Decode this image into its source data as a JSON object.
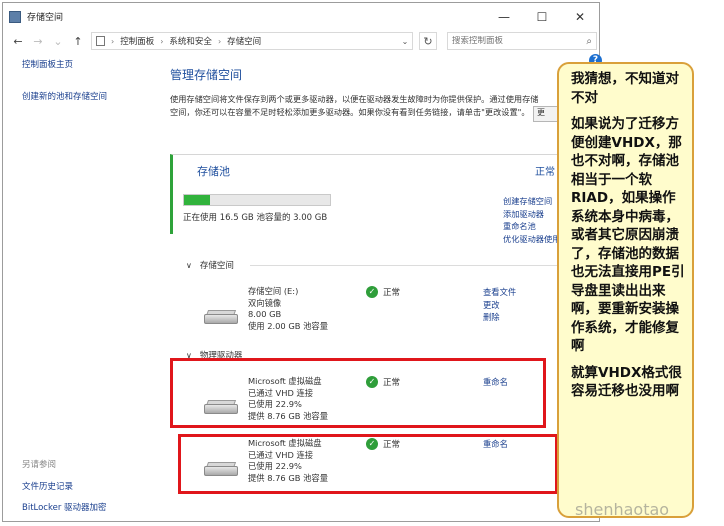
{
  "window": {
    "title": "存储空间",
    "buttons": {
      "minimize": "—",
      "maximize": "☐",
      "close": "✕"
    }
  },
  "address": {
    "back": "←",
    "forward": "→",
    "up": "↑",
    "crumbs": [
      "控制面板",
      "系统和安全",
      "存储空间"
    ],
    "search_placeholder": "搜索控制面板"
  },
  "leftnav": {
    "links": [
      "控制面板主页",
      "创建新的池和存储空间"
    ],
    "see_also": "另请参阅",
    "bottom_links": [
      "文件历史记录",
      "BitLocker 驱动器加密"
    ]
  },
  "main": {
    "title": "管理存储空间",
    "description": "使用存储空间将文件保存到两个或更多驱动器，以便在驱动器发生故障时为你提供保护。通过使用存储空间，你还可以在容量不足时轻松添加更多驱动器。如果你没有看到任务链接，请单击\"更改设置\"。",
    "change_settings": "更"
  },
  "pool": {
    "title": "存储池",
    "status": "正常",
    "usage_fraction": 0.18,
    "usage_text": "正在使用 16.5 GB 池容量的 3.00 GB",
    "links": [
      "创建存储空间",
      "添加驱动器",
      "重命名池",
      "优化驱动器使用"
    ]
  },
  "spaces_section": {
    "label": "存储空间"
  },
  "space": {
    "name": "存储空间 (E:)",
    "type": "双向镜像",
    "size": "8.00 GB",
    "pool_usage": "使用 2.00 GB 池容量",
    "status": "正常",
    "links": [
      "查看文件",
      "更改",
      "删除"
    ]
  },
  "drives_section": {
    "label": "物理驱动器"
  },
  "drives": [
    {
      "name": "Microsoft 虚拟磁盘",
      "connection": "已通过 VHD 连接",
      "used": "已使用 22.9%",
      "provided": "提供 8.76 GB 池容量",
      "status": "正常",
      "link": "重命名"
    },
    {
      "name": "Microsoft 虚拟磁盘",
      "connection": "已通过 VHD 连接",
      "used": "已使用 22.9%",
      "provided": "提供 8.76 GB 池容量",
      "status": "正常",
      "link": "重命名"
    }
  ],
  "callout": {
    "paragraphs": [
      "我猜想，不知道对不对",
      "如果说为了迁移方便创建VHDX，那也不对啊，存储池相当于一个软RIAD，如果操作系统本身中病毒，或者其它原因崩溃了，存储池的数据也无法直接用PE引导盘里读出出来啊，要重新安装操作系统，才能修复啊",
      "就算VHDX格式很容易迁移也没用啊"
    ]
  },
  "watermark": "shenhaotao",
  "colors": {
    "accent_link": "#1a3f8e",
    "title_blue": "#1f4f9e",
    "pool_green": "#31b33c",
    "highlight_red": "#e0161b",
    "callout_bg": "#fffccc",
    "callout_border": "#d9a03a"
  }
}
